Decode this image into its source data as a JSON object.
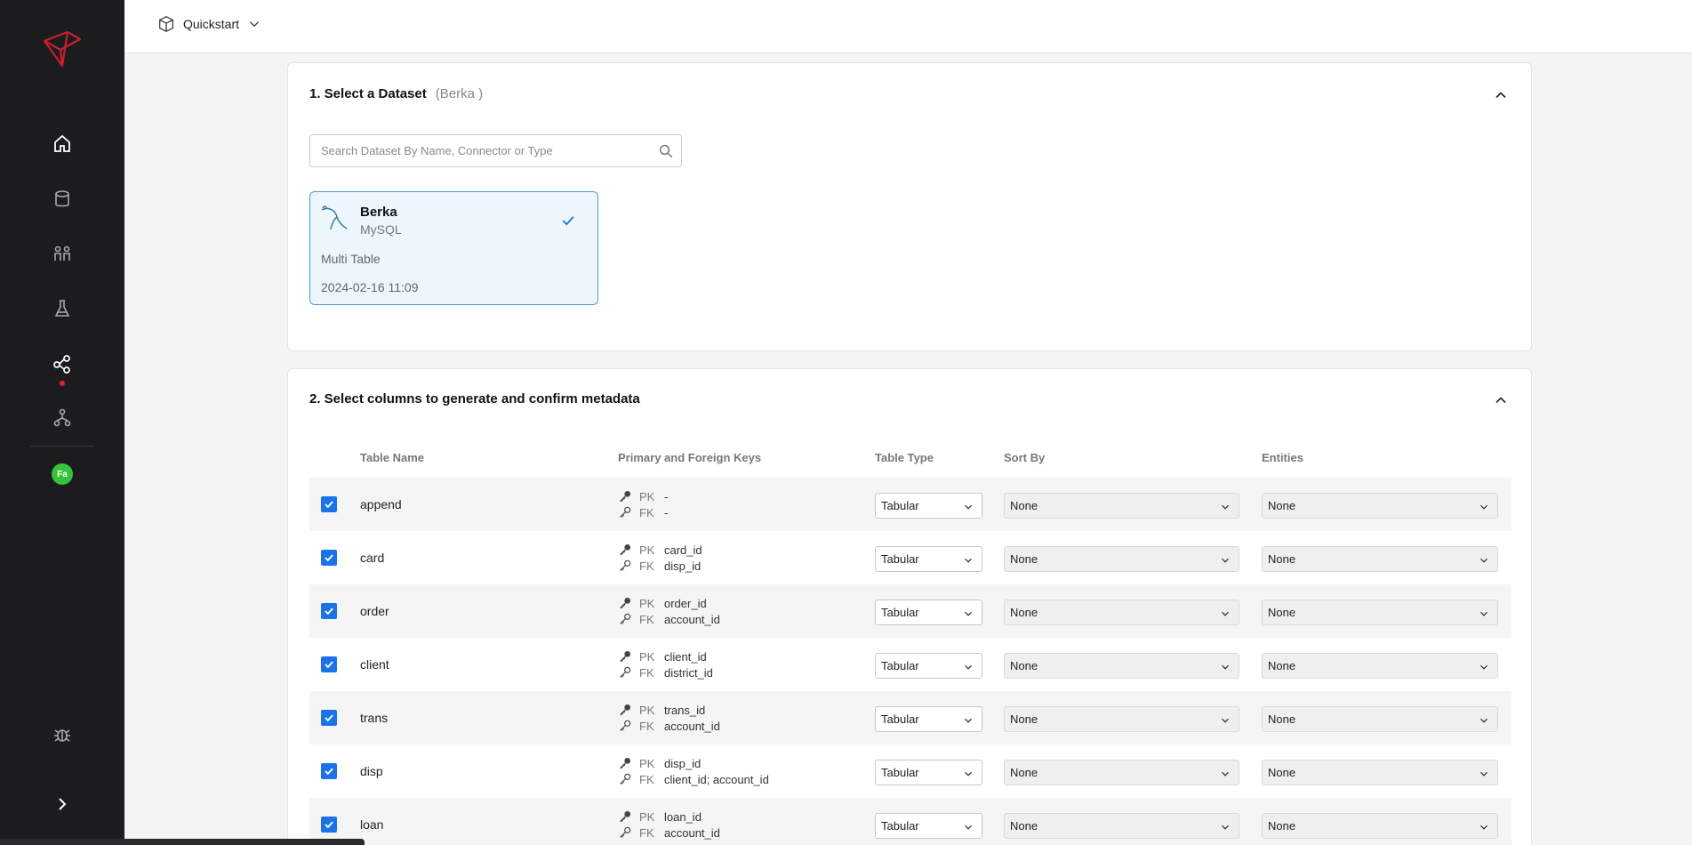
{
  "header": {
    "breadcrumb": "Quickstart"
  },
  "section1": {
    "title": "1. Select a Dataset",
    "selected": "(Berka )",
    "search_placeholder": "Search Dataset By Name, Connector or Type",
    "dataset": {
      "name": "Berka",
      "connector": "MySQL",
      "kind": "Multi Table",
      "date": "2024-02-16 11:09"
    }
  },
  "section2": {
    "title": "2. Select columns to generate and confirm metadata",
    "columns": {
      "table_name": "Table Name",
      "keys": "Primary and Foreign Keys",
      "table_type": "Table Type",
      "sort_by": "Sort By",
      "entities": "Entities"
    },
    "key_labels": {
      "pk": "PK",
      "fk": "FK"
    },
    "rows": [
      {
        "name": "append",
        "pk": "-",
        "fk": "-",
        "type": "Tabular",
        "sort": "None",
        "entities": "None",
        "checked": true
      },
      {
        "name": "card",
        "pk": "card_id",
        "fk": "disp_id",
        "type": "Tabular",
        "sort": "None",
        "entities": "None",
        "checked": true
      },
      {
        "name": "order",
        "pk": "order_id",
        "fk": "account_id",
        "type": "Tabular",
        "sort": "None",
        "entities": "None",
        "checked": true
      },
      {
        "name": "client",
        "pk": "client_id",
        "fk": "district_id",
        "type": "Tabular",
        "sort": "None",
        "entities": "None",
        "checked": true
      },
      {
        "name": "trans",
        "pk": "trans_id",
        "fk": "account_id",
        "type": "Tabular",
        "sort": "None",
        "entities": "None",
        "checked": true
      },
      {
        "name": "disp",
        "pk": "disp_id",
        "fk": "client_id; account_id",
        "type": "Tabular",
        "sort": "None",
        "entities": "None",
        "checked": true
      },
      {
        "name": "loan",
        "pk": "loan_id",
        "fk": "account_id",
        "type": "Tabular",
        "sort": "None",
        "entities": "None",
        "checked": true
      }
    ]
  },
  "user": {
    "initials": "Fa"
  },
  "colors": {
    "accent": "#1a73e8",
    "sidebar": "#1c1c1f",
    "brand": "#c8202a",
    "avatar": "#37c23b"
  },
  "icons": [
    "logo-icon",
    "home-icon",
    "database-icon",
    "people-icon",
    "flask-icon",
    "share-icon",
    "org-icon",
    "bug-icon",
    "chevron-right-icon"
  ]
}
